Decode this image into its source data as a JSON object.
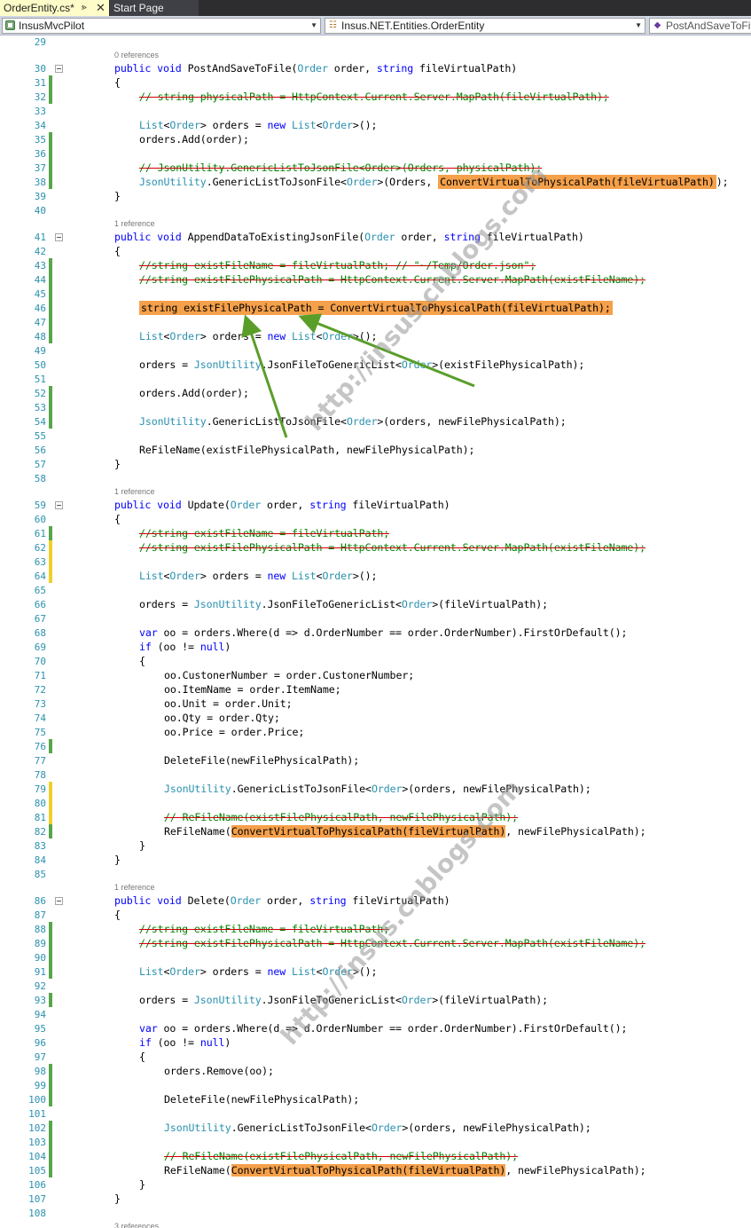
{
  "tabs": {
    "active": "OrderEntity.cs*",
    "inactive": "Start Page",
    "pin_icon": "pin-icon",
    "close_icon": "close-icon"
  },
  "navbar": {
    "project": "InsusMvcPilot",
    "class": "Insus.NET.Entities.OrderEntity",
    "member": "PostAndSaveToFile"
  },
  "watermark": "http://insus.cnblogs.com",
  "lines": [
    {
      "n": "29",
      "c": "",
      "tokens": []
    },
    {
      "lens": "0 references"
    },
    {
      "n": "30",
      "c": "",
      "fold": true,
      "tokens": [
        [
          "kw",
          "public "
        ],
        [
          "kw",
          "void "
        ],
        [
          "",
          "PostAndSaveToFile("
        ],
        [
          "ty",
          "Order"
        ],
        [
          "",
          " order, "
        ],
        [
          "kw",
          "string "
        ],
        [
          "",
          "fileVirtualPath)"
        ]
      ],
      "indent": 1
    },
    {
      "n": "31",
      "c": "saved",
      "tokens": [
        [
          "",
          "{"
        ]
      ],
      "indent": 1
    },
    {
      "n": "32",
      "c": "saved",
      "tokens": [
        [
          "cm",
          "// string physicalPath = HttpContext.Current.Server.MapPath(fileVirtualPath);"
        ]
      ],
      "indent": 2
    },
    {
      "n": "33",
      "c": "",
      "tokens": [],
      "indent": 2
    },
    {
      "n": "34",
      "c": "",
      "tokens": [
        [
          "ty",
          "List"
        ],
        [
          "",
          "<"
        ],
        [
          "ty",
          "Order"
        ],
        [
          "",
          "> orders = "
        ],
        [
          "kw",
          "new "
        ],
        [
          "ty",
          "List"
        ],
        [
          "",
          "<"
        ],
        [
          "ty",
          "Order"
        ],
        [
          "",
          ">();"
        ]
      ],
      "indent": 2
    },
    {
      "n": "35",
      "c": "saved",
      "tokens": [
        [
          "",
          "orders.Add(order);"
        ]
      ],
      "indent": 2
    },
    {
      "n": "36",
      "c": "saved",
      "tokens": [],
      "indent": 2
    },
    {
      "n": "37",
      "c": "saved",
      "tokens": [
        [
          "cm",
          "// JsonUtility.GenericListToJsonFile<Order>(Orders, physicalPath);"
        ]
      ],
      "indent": 2
    },
    {
      "n": "38",
      "c": "saved",
      "tokens": [
        [
          "ty",
          "JsonUtility"
        ],
        [
          "",
          ".GenericListToJsonFile<"
        ],
        [
          "ty",
          "Order"
        ],
        [
          "",
          ">(Orders, "
        ],
        [
          "hlbox",
          "ConvertVirtualToPhysicalPath(fileVirtualPath)"
        ],
        [
          "",
          ");"
        ]
      ],
      "indent": 2
    },
    {
      "n": "39",
      "c": "",
      "tokens": [
        [
          "",
          "}"
        ]
      ],
      "indent": 1
    },
    {
      "n": "40",
      "c": "",
      "tokens": []
    },
    {
      "lens": "1 reference"
    },
    {
      "n": "41",
      "c": "",
      "fold": true,
      "tokens": [
        [
          "kw",
          "public "
        ],
        [
          "kw",
          "void "
        ],
        [
          "",
          "AppendDataToExistingJsonFile("
        ],
        [
          "ty",
          "Order"
        ],
        [
          "",
          " order, "
        ],
        [
          "kw",
          "string "
        ],
        [
          "",
          "fileVirtualPath)"
        ]
      ],
      "indent": 1
    },
    {
      "n": "42",
      "c": "",
      "tokens": [
        [
          "",
          "{"
        ]
      ],
      "indent": 1
    },
    {
      "n": "43",
      "c": "saved",
      "tokens": [
        [
          "cm",
          "//string existFileName = fileVirtualPath; // \"~/Temp/Order.json\";"
        ]
      ],
      "indent": 2
    },
    {
      "n": "44",
      "c": "saved",
      "tokens": [
        [
          "cm",
          "//string existFilePhysicalPath = HttpContext.Current.Server.MapPath(existFileName);"
        ]
      ],
      "indent": 2
    },
    {
      "n": "45",
      "c": "saved",
      "tokens": [],
      "indent": 2
    },
    {
      "n": "46",
      "c": "saved",
      "tokens": [
        [
          "hlbox",
          "string existFilePhysicalPath = ConvertVirtualToPhysicalPath(fileVirtualPath);"
        ]
      ],
      "indent": 2
    },
    {
      "n": "47",
      "c": "saved",
      "tokens": [],
      "indent": 2
    },
    {
      "n": "48",
      "c": "saved",
      "tokens": [
        [
          "ty",
          "List"
        ],
        [
          "",
          "<"
        ],
        [
          "ty",
          "Order"
        ],
        [
          "",
          "> orders = "
        ],
        [
          "kw",
          "new "
        ],
        [
          "ty",
          "List"
        ],
        [
          "",
          "<"
        ],
        [
          "ty",
          "Order"
        ],
        [
          "",
          ">();"
        ]
      ],
      "indent": 2
    },
    {
      "n": "49",
      "c": "",
      "tokens": [],
      "indent": 2
    },
    {
      "n": "50",
      "c": "",
      "tokens": [
        [
          "",
          "orders = "
        ],
        [
          "ty",
          "JsonUtility"
        ],
        [
          "",
          ".JsonFileToGenericList<"
        ],
        [
          "ty",
          "Order"
        ],
        [
          "",
          ">(existFilePhysicalPath);"
        ]
      ],
      "indent": 2
    },
    {
      "n": "51",
      "c": "",
      "tokens": [],
      "indent": 2
    },
    {
      "n": "52",
      "c": "saved",
      "tokens": [
        [
          "",
          "orders.Add(order);"
        ]
      ],
      "indent": 2
    },
    {
      "n": "53",
      "c": "saved",
      "tokens": [],
      "indent": 2
    },
    {
      "n": "54",
      "c": "saved",
      "tokens": [
        [
          "ty",
          "JsonUtility"
        ],
        [
          "",
          ".GenericListToJsonFile<"
        ],
        [
          "ty",
          "Order"
        ],
        [
          "",
          ">(orders, newFilePhysicalPath);"
        ]
      ],
      "indent": 2
    },
    {
      "n": "55",
      "c": "",
      "tokens": [],
      "indent": 2
    },
    {
      "n": "56",
      "c": "",
      "tokens": [
        [
          "",
          "ReFileName(existFilePhysicalPath, newFilePhysicalPath);"
        ]
      ],
      "indent": 2
    },
    {
      "n": "57",
      "c": "",
      "tokens": [
        [
          "",
          "}"
        ]
      ],
      "indent": 1
    },
    {
      "n": "58",
      "c": "",
      "tokens": []
    },
    {
      "lens": "1 reference"
    },
    {
      "n": "59",
      "c": "",
      "fold": true,
      "tokens": [
        [
          "kw",
          "public "
        ],
        [
          "kw",
          "void "
        ],
        [
          "",
          "Update("
        ],
        [
          "ty",
          "Order"
        ],
        [
          "",
          " order, "
        ],
        [
          "kw",
          "string "
        ],
        [
          "",
          "fileVirtualPath)"
        ]
      ],
      "indent": 1
    },
    {
      "n": "60",
      "c": "",
      "tokens": [
        [
          "",
          "{"
        ]
      ],
      "indent": 1
    },
    {
      "n": "61",
      "c": "saved",
      "tokens": [
        [
          "cm",
          "//string existFileName = fileVirtualPath;"
        ]
      ],
      "indent": 2
    },
    {
      "n": "62",
      "c": "unsaved",
      "tokens": [
        [
          "cm",
          "//string existFilePhysicalPath = HttpContext.Current.Server.MapPath(existFileName);"
        ]
      ],
      "indent": 2
    },
    {
      "n": "63",
      "c": "unsaved",
      "tokens": [],
      "indent": 2
    },
    {
      "n": "64",
      "c": "unsaved",
      "tokens": [
        [
          "ty",
          "List"
        ],
        [
          "",
          "<"
        ],
        [
          "ty",
          "Order"
        ],
        [
          "",
          "> orders = "
        ],
        [
          "kw",
          "new "
        ],
        [
          "ty",
          "List"
        ],
        [
          "",
          "<"
        ],
        [
          "ty",
          "Order"
        ],
        [
          "",
          ">();"
        ]
      ],
      "indent": 2
    },
    {
      "n": "65",
      "c": "",
      "tokens": [],
      "indent": 2
    },
    {
      "n": "66",
      "c": "",
      "tokens": [
        [
          "",
          "orders = "
        ],
        [
          "ty",
          "JsonUtility"
        ],
        [
          "",
          ".JsonFileToGenericList<"
        ],
        [
          "ty",
          "Order"
        ],
        [
          "",
          ">(fileVirtualPath);"
        ]
      ],
      "indent": 2
    },
    {
      "n": "67",
      "c": "",
      "tokens": [],
      "indent": 2
    },
    {
      "n": "68",
      "c": "",
      "tokens": [
        [
          "kw",
          "var "
        ],
        [
          "",
          "oo = orders.Where(d => d.OrderNumber == order.OrderNumber).FirstOrDefault();"
        ]
      ],
      "indent": 2
    },
    {
      "n": "69",
      "c": "",
      "tokens": [
        [
          "kw",
          "if "
        ],
        [
          "",
          "(oo != "
        ],
        [
          "kw",
          "null"
        ],
        [
          "",
          ")"
        ]
      ],
      "indent": 2
    },
    {
      "n": "70",
      "c": "",
      "tokens": [
        [
          "",
          "{"
        ]
      ],
      "indent": 2
    },
    {
      "n": "71",
      "c": "",
      "tokens": [
        [
          "",
          "oo.CustonerNumber = order.CustonerNumber;"
        ]
      ],
      "indent": 3
    },
    {
      "n": "72",
      "c": "",
      "tokens": [
        [
          "",
          "oo.ItemName = order.ItemName;"
        ]
      ],
      "indent": 3
    },
    {
      "n": "73",
      "c": "",
      "tokens": [
        [
          "",
          "oo.Unit = order.Unit;"
        ]
      ],
      "indent": 3
    },
    {
      "n": "74",
      "c": "",
      "tokens": [
        [
          "",
          "oo.Qty = order.Qty;"
        ]
      ],
      "indent": 3
    },
    {
      "n": "75",
      "c": "",
      "tokens": [
        [
          "",
          "oo.Price = order.Price;"
        ]
      ],
      "indent": 3
    },
    {
      "n": "76",
      "c": "saved",
      "tokens": [],
      "indent": 3
    },
    {
      "n": "77",
      "c": "",
      "tokens": [
        [
          "",
          "DeleteFile(newFilePhysicalPath);"
        ]
      ],
      "indent": 3
    },
    {
      "n": "78",
      "c": "",
      "tokens": [],
      "indent": 3
    },
    {
      "n": "79",
      "c": "unsaved",
      "tokens": [
        [
          "ty",
          "JsonUtility"
        ],
        [
          "",
          ".GenericListToJsonFile<"
        ],
        [
          "ty",
          "Order"
        ],
        [
          "",
          ">(orders, newFilePhysicalPath);"
        ]
      ],
      "indent": 3
    },
    {
      "n": "80",
      "c": "unsaved",
      "tokens": [],
      "indent": 3
    },
    {
      "n": "81",
      "c": "unsaved",
      "tokens": [
        [
          "cm",
          "// ReFileName(existFilePhysicalPath, newFilePhysicalPath);"
        ]
      ],
      "indent": 3
    },
    {
      "n": "82",
      "c": "saved",
      "tokens": [
        [
          "",
          "ReFileName("
        ],
        [
          "hl",
          "ConvertVirtualToPhysicalPath(fileVirtualPath)"
        ],
        [
          "",
          ", newFilePhysicalPath);"
        ]
      ],
      "indent": 3
    },
    {
      "n": "83",
      "c": "",
      "tokens": [
        [
          "",
          "}"
        ]
      ],
      "indent": 2
    },
    {
      "n": "84",
      "c": "",
      "tokens": [
        [
          "",
          "}"
        ]
      ],
      "indent": 1
    },
    {
      "n": "85",
      "c": "",
      "tokens": []
    },
    {
      "lens": "1 reference"
    },
    {
      "n": "86",
      "c": "",
      "fold": true,
      "tokens": [
        [
          "kw",
          "public "
        ],
        [
          "kw",
          "void "
        ],
        [
          "",
          "Delete("
        ],
        [
          "ty",
          "Order"
        ],
        [
          "",
          " order, "
        ],
        [
          "kw",
          "string "
        ],
        [
          "",
          "fileVirtualPath)"
        ]
      ],
      "indent": 1
    },
    {
      "n": "87",
      "c": "",
      "tokens": [
        [
          "",
          "{"
        ]
      ],
      "indent": 1
    },
    {
      "n": "88",
      "c": "saved",
      "tokens": [
        [
          "cm",
          "//string existFileName = fileVirtualPath;"
        ]
      ],
      "indent": 2
    },
    {
      "n": "89",
      "c": "saved",
      "tokens": [
        [
          "cm",
          "//string existFilePhysicalPath = HttpContext.Current.Server.MapPath(existFileName);"
        ]
      ],
      "indent": 2
    },
    {
      "n": "90",
      "c": "saved",
      "tokens": [],
      "indent": 2
    },
    {
      "n": "91",
      "c": "saved",
      "tokens": [
        [
          "ty",
          "List"
        ],
        [
          "",
          "<"
        ],
        [
          "ty",
          "Order"
        ],
        [
          "",
          "> orders = "
        ],
        [
          "kw",
          "new "
        ],
        [
          "ty",
          "List"
        ],
        [
          "",
          "<"
        ],
        [
          "ty",
          "Order"
        ],
        [
          "",
          ">();"
        ]
      ],
      "indent": 2
    },
    {
      "n": "92",
      "c": "",
      "tokens": [],
      "indent": 2
    },
    {
      "n": "93",
      "c": "saved",
      "tokens": [
        [
          "",
          "orders = "
        ],
        [
          "ty",
          "JsonUtility"
        ],
        [
          "",
          ".JsonFileToGenericList<"
        ],
        [
          "ty",
          "Order"
        ],
        [
          "",
          ">(fileVirtualPath);"
        ]
      ],
      "indent": 2
    },
    {
      "n": "94",
      "c": "",
      "tokens": [],
      "indent": 2
    },
    {
      "n": "95",
      "c": "",
      "tokens": [
        [
          "kw",
          "var "
        ],
        [
          "",
          "oo = orders.Where(d => d.OrderNumber == order.OrderNumber).FirstOrDefault();"
        ]
      ],
      "indent": 2
    },
    {
      "n": "96",
      "c": "",
      "tokens": [
        [
          "kw",
          "if "
        ],
        [
          "",
          "(oo != "
        ],
        [
          "kw",
          "null"
        ],
        [
          "",
          ")"
        ]
      ],
      "indent": 2
    },
    {
      "n": "97",
      "c": "",
      "tokens": [
        [
          "",
          "{"
        ]
      ],
      "indent": 2
    },
    {
      "n": "98",
      "c": "saved",
      "tokens": [
        [
          "",
          "orders.Remove(oo);"
        ]
      ],
      "indent": 3
    },
    {
      "n": "99",
      "c": "saved",
      "tokens": [],
      "indent": 3
    },
    {
      "n": "100",
      "c": "saved",
      "tokens": [
        [
          "",
          "DeleteFile(newFilePhysicalPath);"
        ]
      ],
      "indent": 3
    },
    {
      "n": "101",
      "c": "",
      "tokens": [],
      "indent": 3
    },
    {
      "n": "102",
      "c": "saved",
      "tokens": [
        [
          "ty",
          "JsonUtility"
        ],
        [
          "",
          ".GenericListToJsonFile<"
        ],
        [
          "ty",
          "Order"
        ],
        [
          "",
          ">(orders, newFilePhysicalPath);"
        ]
      ],
      "indent": 3
    },
    {
      "n": "103",
      "c": "saved",
      "tokens": [],
      "indent": 3
    },
    {
      "n": "104",
      "c": "saved",
      "tokens": [
        [
          "cm",
          "// ReFileName(existFilePhysicalPath, newFilePhysicalPath);"
        ]
      ],
      "indent": 3
    },
    {
      "n": "105",
      "c": "saved",
      "tokens": [
        [
          "",
          "ReFileName("
        ],
        [
          "hl",
          "ConvertVirtualToPhysicalPath(fileVirtualPath)"
        ],
        [
          "",
          ", newFilePhysicalPath);"
        ]
      ],
      "indent": 3
    },
    {
      "n": "106",
      "c": "",
      "tokens": [
        [
          "",
          "}"
        ]
      ],
      "indent": 2
    },
    {
      "n": "107",
      "c": "",
      "tokens": [
        [
          "",
          "}"
        ]
      ],
      "indent": 1
    },
    {
      "n": "108",
      "c": "",
      "tokens": []
    },
    {
      "lens": "3 references"
    }
  ]
}
